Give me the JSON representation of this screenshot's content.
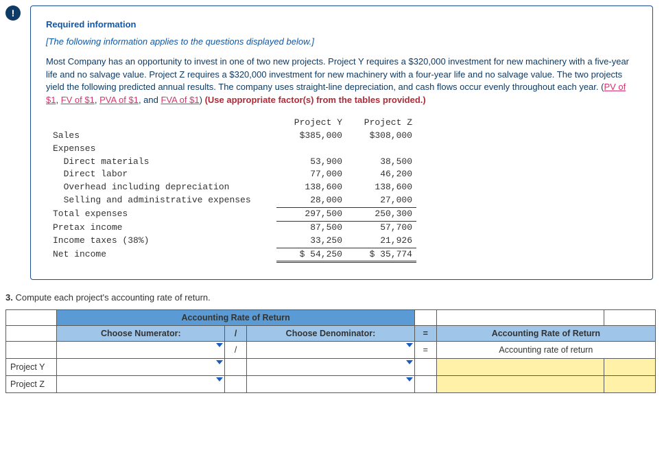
{
  "header": {
    "icon_name": "exclamation-icon",
    "required_label": "Required information",
    "intro": "[The following information applies to the questions displayed below.]",
    "body_pre": "Most Company has an opportunity to invest in one of two new projects. Project Y requires a $320,000 investment for new machinery with a five-year life and no salvage value. Project Z requires a $320,000 investment for new machinery with a four-year life and no salvage value. The two projects yield the following predicted annual results. The company uses straight-line depreciation, and cash flows occur evenly throughout each year. (",
    "links": {
      "pv": "PV of $1",
      "fv": "FV of $1",
      "pva": "PVA of $1",
      "fva": "FVA of $1"
    },
    "body_post": ") ",
    "bold_note": "(Use appropriate factor(s) from the tables provided.)"
  },
  "income": {
    "header_y": "Project Y",
    "header_z": "Project Z",
    "rows": {
      "sales": {
        "label": "Sales",
        "y": "$385,000",
        "z": "$308,000"
      },
      "expenses_label": "Expenses",
      "dm": {
        "label": "  Direct materials",
        "y": "53,900",
        "z": "38,500"
      },
      "dl": {
        "label": "  Direct labor",
        "y": "77,000",
        "z": "46,200"
      },
      "oh": {
        "label": "  Overhead including depreciation",
        "y": "138,600",
        "z": "138,600"
      },
      "sae": {
        "label": "  Selling and administrative expenses",
        "y": "28,000",
        "z": "27,000"
      },
      "te": {
        "label": "Total expenses",
        "y": "297,500",
        "z": "250,300"
      },
      "pti": {
        "label": "Pretax income",
        "y": "87,500",
        "z": "57,700"
      },
      "tax": {
        "label": "Income taxes (38%)",
        "y": "33,250",
        "z": "21,926"
      },
      "ni": {
        "label": "Net income",
        "y": "$ 54,250",
        "z": "$ 35,774"
      }
    }
  },
  "question": {
    "num": "3.",
    "text": "Compute each project's accounting rate of return."
  },
  "arr": {
    "title": "Accounting Rate of Return",
    "num_head": "Choose Numerator:",
    "slash": "/",
    "den_head": "Choose Denominator:",
    "eq": "=",
    "result_head": "Accounting Rate of Return",
    "row1_result": "Accounting rate of return",
    "proj_y": "Project Y",
    "proj_z": "Project Z"
  }
}
